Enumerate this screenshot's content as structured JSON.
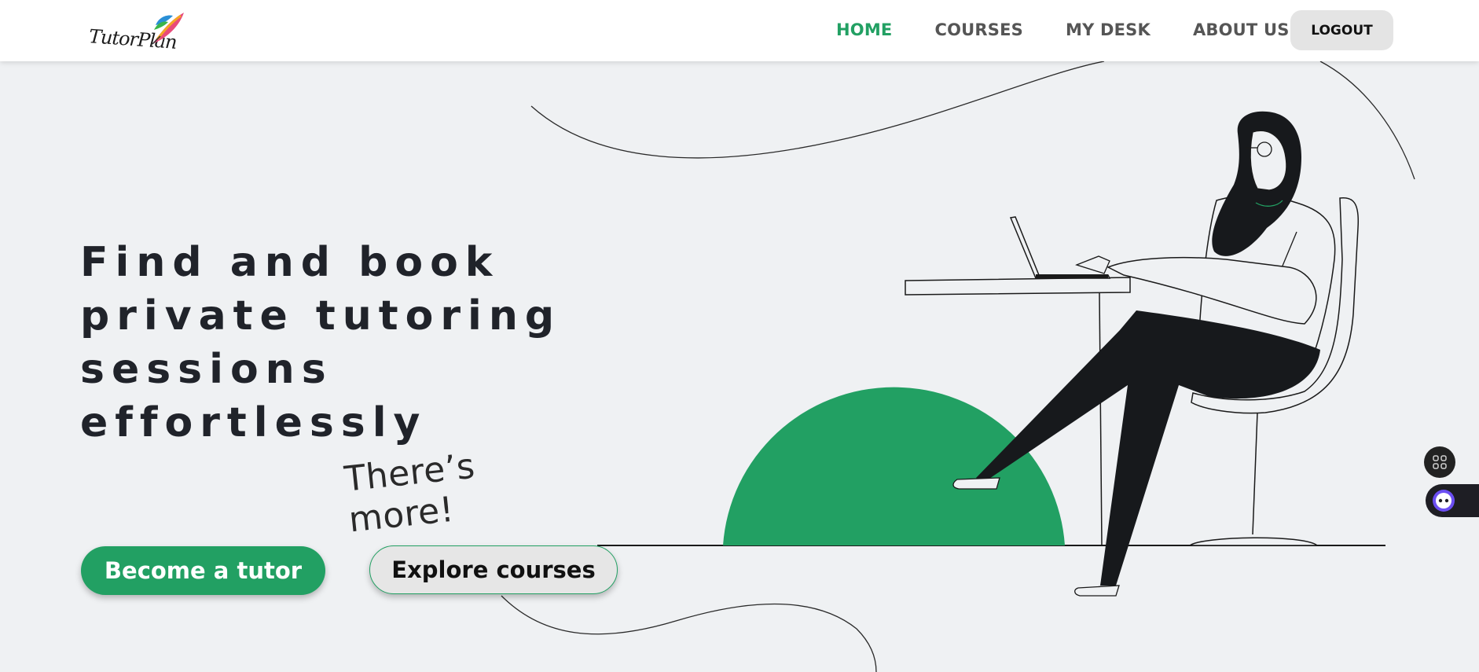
{
  "brand": {
    "logo_text": "TutorPlan",
    "accent_color": "#22a063"
  },
  "nav": {
    "items": [
      {
        "label": "HOME",
        "active": true
      },
      {
        "label": "COURSES",
        "active": false
      },
      {
        "label": "MY DESK",
        "active": false
      },
      {
        "label": "ABOUT US",
        "active": false
      }
    ],
    "logout_label": "LOGOUT"
  },
  "hero": {
    "title_lines": [
      "Find and book",
      "private tutoring",
      "sessions",
      "effortlessly"
    ],
    "handwritten_note_lines": [
      "There’s",
      "more!"
    ],
    "primary_button": "Become a tutor",
    "secondary_button": "Explore courses"
  },
  "illustration": {
    "subject": "woman-typing-on-laptop-icon",
    "semicircle_color": "#22a063"
  },
  "side_widgets": [
    {
      "icon": "apps-grid-icon"
    },
    {
      "icon": "assistant-bot-icon"
    }
  ]
}
